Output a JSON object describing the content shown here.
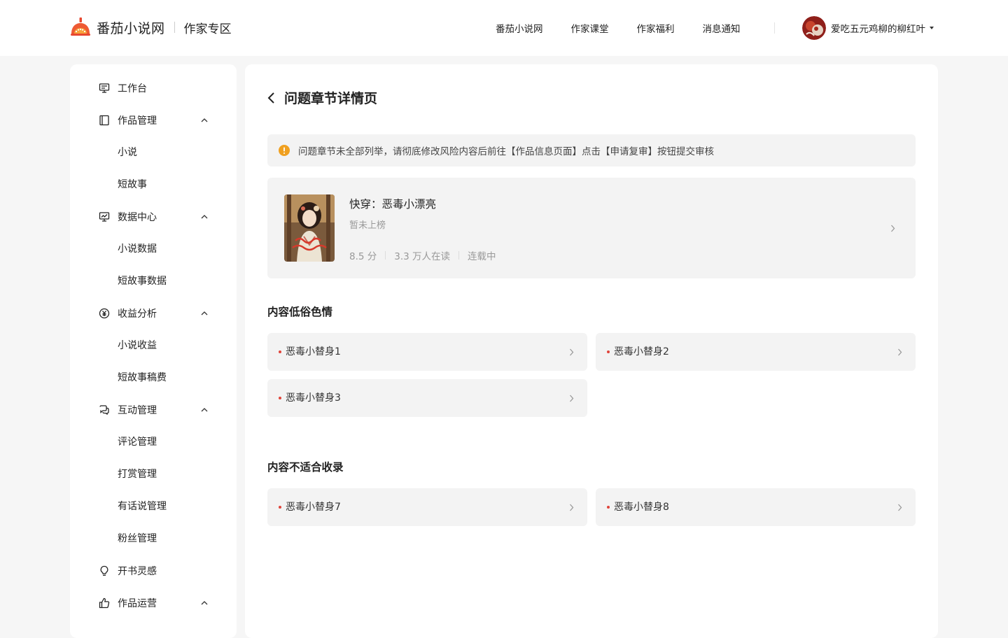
{
  "header": {
    "site_name": "番茄小说网",
    "zone_name": "作家专区",
    "nav": [
      "番茄小说网",
      "作家课堂",
      "作家福利",
      "消息通知"
    ],
    "user_name": "爱吃五元鸡柳的柳红叶"
  },
  "sidebar": {
    "items": [
      {
        "label": "工作台",
        "icon": "monitor-icon"
      },
      {
        "label": "作品管理",
        "icon": "book-icon",
        "expanded": true,
        "children": [
          "小说",
          "短故事"
        ]
      },
      {
        "label": "数据中心",
        "icon": "chart-icon",
        "expanded": true,
        "children": [
          "小说数据",
          "短故事数据"
        ]
      },
      {
        "label": "收益分析",
        "icon": "yen-icon",
        "expanded": true,
        "children": [
          "小说收益",
          "短故事稿费"
        ]
      },
      {
        "label": "互动管理",
        "icon": "chat-icon",
        "expanded": true,
        "children": [
          "评论管理",
          "打赏管理",
          "有话说管理",
          "粉丝管理"
        ]
      },
      {
        "label": "开书灵感",
        "icon": "lightbulb-icon"
      },
      {
        "label": "作品运营",
        "icon": "thumbs-up-icon",
        "expanded": true
      }
    ]
  },
  "main": {
    "title": "问题章节详情页",
    "notice": "问题章节未全部列举，请彻底修改风险内容后前往【作品信息页面】点击【申请复审】按钮提交审核",
    "book": {
      "title": "快穿：恶毒小漂亮",
      "rank": "暂未上榜",
      "score": "8.5 分",
      "readers": "3.3 万人在读",
      "status": "连载中"
    },
    "sections": [
      {
        "title": "内容低俗色情",
        "chapters": [
          "恶毒小替身1",
          "恶毒小替身2",
          "恶毒小替身3"
        ]
      },
      {
        "title": "内容不适合收录",
        "chapters": [
          "恶毒小替身7",
          "恶毒小替身8"
        ]
      }
    ]
  },
  "colors": {
    "brand": "#e8472f",
    "warning": "#f0a020",
    "dot": "#e0443a"
  }
}
